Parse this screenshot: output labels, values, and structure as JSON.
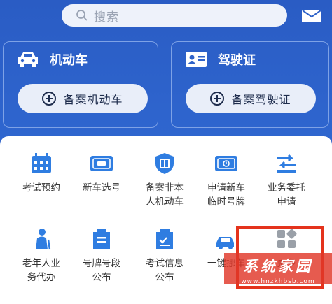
{
  "search": {
    "placeholder": "搜索"
  },
  "cards": [
    {
      "title": "机动车",
      "button": "备案机动车"
    },
    {
      "title": "驾驶证",
      "button": "备案驾驶证"
    }
  ],
  "services": [
    {
      "label": "考试预约"
    },
    {
      "label": "新车选号"
    },
    {
      "label": "备案非本人机动车"
    },
    {
      "label": "申请新车临时号牌"
    },
    {
      "label": "业务委托申请"
    },
    {
      "label": "老年人业务代办"
    },
    {
      "label": "号牌号段公布"
    },
    {
      "label": "考试信息公布"
    },
    {
      "label": "一键挪车"
    },
    {
      "label": "更多"
    }
  ],
  "watermark": {
    "text": "系统家园",
    "sub": "www.hnzkhbsb.com"
  },
  "colors": {
    "brand": "#2f63c9",
    "icon": "#2f7de1",
    "highlight": "#e4331c"
  }
}
